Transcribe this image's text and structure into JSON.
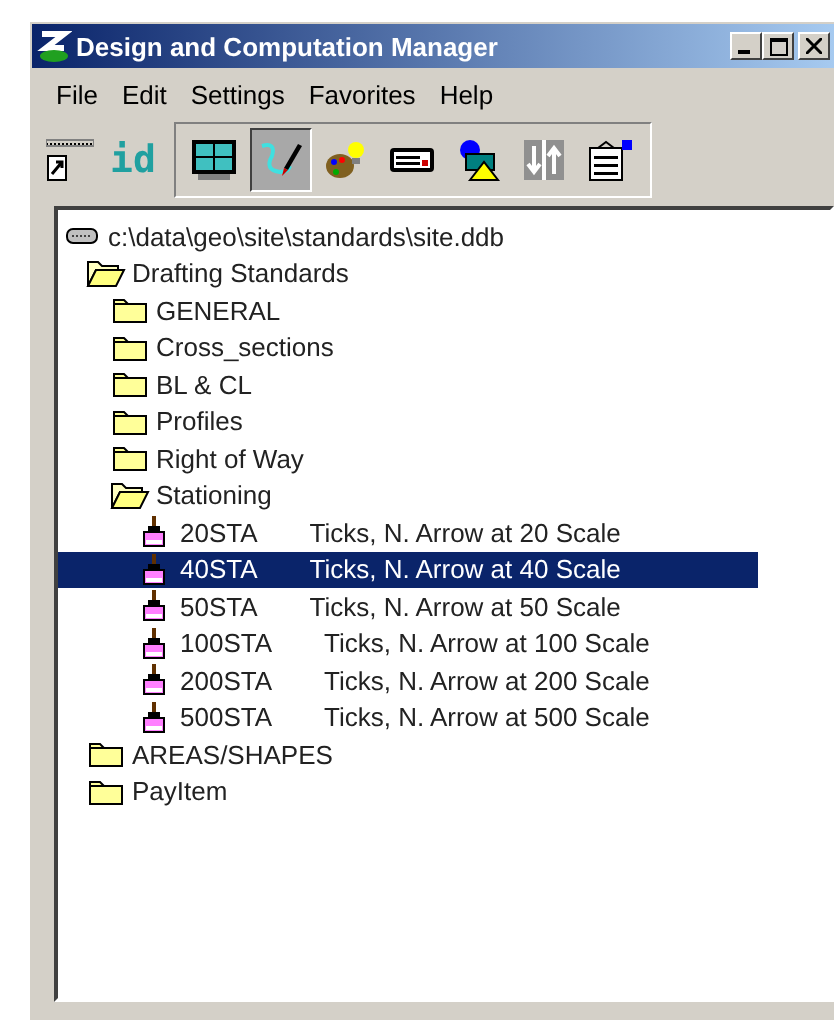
{
  "window": {
    "title": "Design and Computation Manager"
  },
  "menu": [
    {
      "label": "File"
    },
    {
      "label": "Edit"
    },
    {
      "label": "Settings"
    },
    {
      "label": "Favorites"
    },
    {
      "label": "Help"
    }
  ],
  "toolbar": {
    "id_label": "id",
    "buttons": [
      {
        "kind": "layout",
        "selected": false
      },
      {
        "kind": "draw",
        "selected": true
      },
      {
        "kind": "palette",
        "selected": false
      },
      {
        "kind": "keypad",
        "selected": false
      },
      {
        "kind": "shapes",
        "selected": false
      },
      {
        "kind": "arrows",
        "selected": false
      },
      {
        "kind": "clipboard",
        "selected": false
      }
    ]
  },
  "tree": {
    "label": "c:\\data\\geo\\site\\standards\\site.ddb",
    "kind": "database",
    "children": [
      {
        "label": "Drafting Standards",
        "kind": "folder",
        "expanded": true,
        "children": [
          {
            "label": "GENERAL",
            "kind": "folder",
            "expanded": false
          },
          {
            "label": "Cross_sections",
            "kind": "folder",
            "expanded": false
          },
          {
            "label": "BL & CL",
            "kind": "folder",
            "expanded": false
          },
          {
            "label": "Profiles",
            "kind": "folder",
            "expanded": false
          },
          {
            "label": "Right of Way",
            "kind": "folder",
            "expanded": false
          },
          {
            "label": "Stationing",
            "kind": "folder",
            "expanded": true,
            "children": [
              {
                "label": "20STA",
                "description": "Ticks, N. Arrow at 20 Scale",
                "kind": "style",
                "selected": false
              },
              {
                "label": "40STA",
                "description": "Ticks, N. Arrow at 40 Scale",
                "kind": "style",
                "selected": true
              },
              {
                "label": "50STA",
                "description": "Ticks, N. Arrow at 50 Scale",
                "kind": "style",
                "selected": false
              },
              {
                "label": "100STA",
                "description": "Ticks, N. Arrow at 100 Scale",
                "kind": "style",
                "selected": false
              },
              {
                "label": "200STA",
                "description": "Ticks, N. Arrow at 200 Scale",
                "kind": "style",
                "selected": false
              },
              {
                "label": "500STA",
                "description": "Ticks, N. Arrow at 500 Scale",
                "kind": "style",
                "selected": false
              }
            ]
          }
        ]
      },
      {
        "label": "AREAS/SHAPES",
        "kind": "folder",
        "expanded": false
      },
      {
        "label": "PayItem",
        "kind": "folder",
        "expanded": false
      }
    ]
  }
}
